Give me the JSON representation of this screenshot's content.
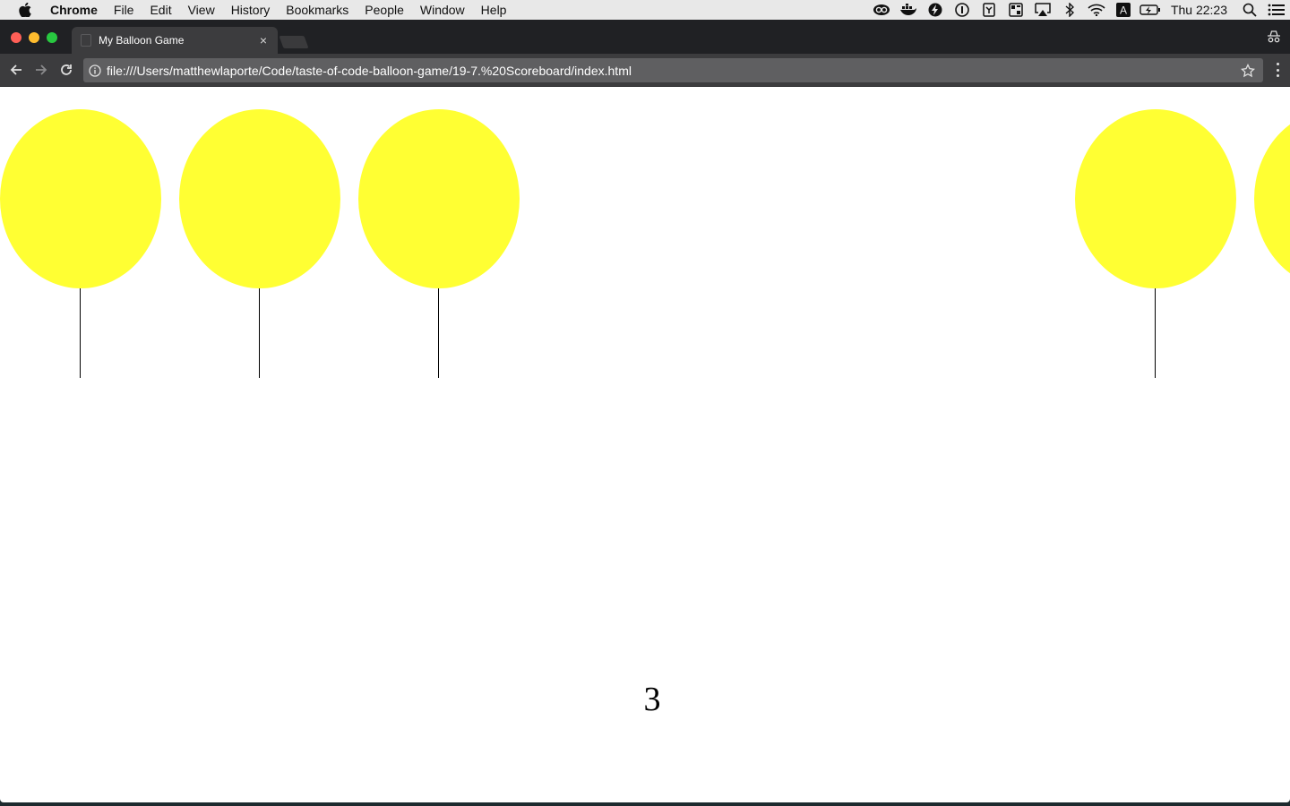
{
  "menubar": {
    "app_name": "Chrome",
    "items": [
      "File",
      "Edit",
      "View",
      "History",
      "Bookmarks",
      "People",
      "Window",
      "Help"
    ],
    "clock": "Thu 22:23",
    "status_icons": [
      "creative-cloud-icon",
      "docker-icon",
      "lightning-icon",
      "1password-icon",
      "contacts-icon",
      "grid-icon",
      "airplay-icon",
      "bluetooth-icon",
      "wifi-icon",
      "input-source-icon",
      "battery-icon",
      "spotlight-icon",
      "notification-center-icon"
    ],
    "input_source_label": "A"
  },
  "browser": {
    "tab_title": "My Balloon Game",
    "tab_close": "×",
    "url": "file:///Users/matthewlaporte/Code/taste-of-code-balloon-game/19-7.%20Scoreboard/index.html"
  },
  "page": {
    "balloon_color": "#ffff33",
    "string_color": "#000000",
    "balloons": [
      {
        "id": "balloon-1"
      },
      {
        "id": "balloon-2"
      },
      {
        "id": "balloon-3"
      },
      {
        "id": "balloon-4"
      },
      {
        "id": "balloon-5"
      }
    ],
    "score": "3"
  }
}
